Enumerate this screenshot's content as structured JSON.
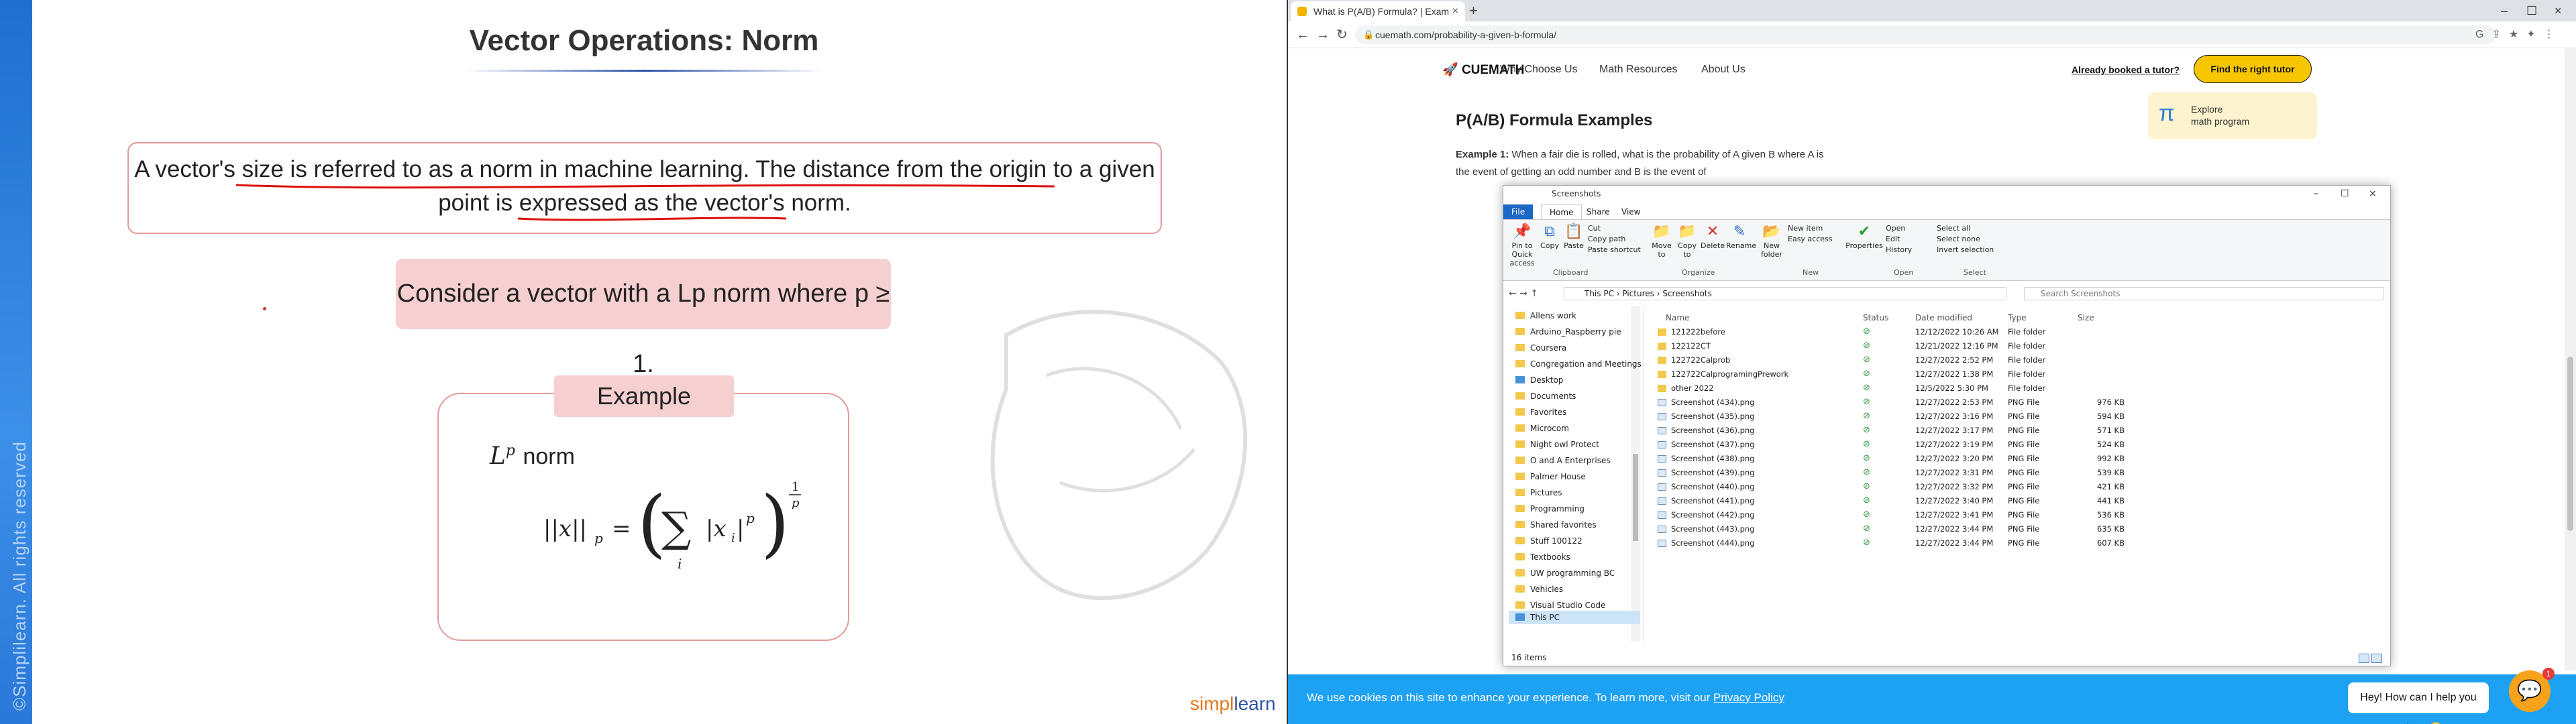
{
  "slide": {
    "title": "Vector Operations: Norm",
    "definition": "A vector's size is referred to as a norm in machine learning. The distance from the origin to a given point is expressed as the vector's norm.",
    "consider": "Consider a vector with a Lp norm where p ≥ 1.",
    "example_label": "Example",
    "lp_norm_label": "norm",
    "copyright": "©Simplilearn. All rights reserved",
    "brand_a": "simpl",
    "brand_b": "learn"
  },
  "browser": {
    "tab_title": "What is P(A/B) Formula? | Exam",
    "tab_close": "×",
    "new_tab": "+",
    "url": "cuemath.com/probability-a-given-b-formula/",
    "win_min": "–",
    "win_max": "☐",
    "win_close": "×"
  },
  "site": {
    "logo": "CUEMATH",
    "nav": [
      "Why Choose Us",
      "Math Resources",
      "About Us"
    ],
    "already_booked": "Already booked a tutor?",
    "find_tutor": "Find the right tutor",
    "explore_title": "Explore",
    "explore_sub": "math program",
    "heading": "P(A/B) Formula Examples",
    "example_bold": "Example 1:",
    "example_text": " When a fair die is rolled, what is the probability of A given B where A is the event of getting an odd number and B is the event of",
    "cookie_text": "We use cookies on this site to enhance your experience. To learn more, visit our",
    "cookie_link": "Privacy Policy",
    "chat_text": "Hey! How can I help you today? 😊",
    "chat_badge": "1"
  },
  "explorer": {
    "title": "Screenshots",
    "ribbon_tabs": [
      "File",
      "Home",
      "Share",
      "View"
    ],
    "buttons": {
      "pin": "Pin to Quick access",
      "copy": "Copy",
      "paste": "Paste",
      "cut": "Cut",
      "copy_path": "Copy path",
      "paste_shortcut": "Paste shortcut",
      "move_to": "Move to",
      "copy_to": "Copy to",
      "delete": "Delete",
      "rename": "Rename",
      "new_folder": "New folder",
      "new_item": "New item",
      "easy_access": "Easy access",
      "properties": "Properties",
      "open": "Open",
      "edit": "Edit",
      "history": "History",
      "select_all": "Select all",
      "select_none": "Select none",
      "invert": "Invert selection"
    },
    "groups": [
      "Clipboard",
      "Organize",
      "New",
      "Open",
      "Select"
    ],
    "breadcrumb": "This PC  ›  Pictures  ›  Screenshots",
    "search_placeholder": "Search Screenshots",
    "columns": [
      "Name",
      "Status",
      "Date modified",
      "Type",
      "Size"
    ],
    "nav_items": [
      "Allens work",
      "Arduino_Raspberry pie",
      "Coursera",
      "Congregation and Meetings",
      "Desktop",
      "Documents",
      "Favorites",
      "Microcom",
      "Night owl Protect",
      "O and A Enterprises",
      "Palmer House",
      "Pictures",
      "Programming",
      "Shared favorites",
      "Stuff 100122",
      "Textbooks",
      "UW programming BC",
      "Vehicles",
      "Visual Studio Code",
      "This PC"
    ],
    "files": [
      {
        "name": "121222before",
        "date": "12/12/2022 10:26 AM",
        "type": "File folder",
        "size": ""
      },
      {
        "name": "122122CT",
        "date": "12/21/2022 12:16 PM",
        "type": "File folder",
        "size": ""
      },
      {
        "name": "122722Calprob",
        "date": "12/27/2022 2:52 PM",
        "type": "File folder",
        "size": ""
      },
      {
        "name": "122722CalprogramingPrework",
        "date": "12/27/2022 1:38 PM",
        "type": "File folder",
        "size": ""
      },
      {
        "name": "other 2022",
        "date": "12/5/2022 5:30 PM",
        "type": "File folder",
        "size": ""
      },
      {
        "name": "Screenshot (434).png",
        "date": "12/27/2022 2:53 PM",
        "type": "PNG File",
        "size": "976 KB"
      },
      {
        "name": "Screenshot (435).png",
        "date": "12/27/2022 3:16 PM",
        "type": "PNG File",
        "size": "594 KB"
      },
      {
        "name": "Screenshot (436).png",
        "date": "12/27/2022 3:17 PM",
        "type": "PNG File",
        "size": "571 KB"
      },
      {
        "name": "Screenshot (437).png",
        "date": "12/27/2022 3:19 PM",
        "type": "PNG File",
        "size": "524 KB"
      },
      {
        "name": "Screenshot (438).png",
        "date": "12/27/2022 3:20 PM",
        "type": "PNG File",
        "size": "992 KB"
      },
      {
        "name": "Screenshot (439).png",
        "date": "12/27/2022 3:31 PM",
        "type": "PNG File",
        "size": "539 KB"
      },
      {
        "name": "Screenshot (440).png",
        "date": "12/27/2022 3:32 PM",
        "type": "PNG File",
        "size": "421 KB"
      },
      {
        "name": "Screenshot (441).png",
        "date": "12/27/2022 3:40 PM",
        "type": "PNG File",
        "size": "441 KB"
      },
      {
        "name": "Screenshot (442).png",
        "date": "12/27/2022 3:41 PM",
        "type": "PNG File",
        "size": "536 KB"
      },
      {
        "name": "Screenshot (443).png",
        "date": "12/27/2022 3:44 PM",
        "type": "PNG File",
        "size": "635 KB"
      },
      {
        "name": "Screenshot (444).png",
        "date": "12/27/2022 3:44 PM",
        "type": "PNG File",
        "size": "607 KB"
      }
    ],
    "item_count": "16 items"
  },
  "colors": {
    "accent_blue": "#1da1f2",
    "tutor_yellow": "#f7c600",
    "slide_pink": "#f6cfd0"
  }
}
